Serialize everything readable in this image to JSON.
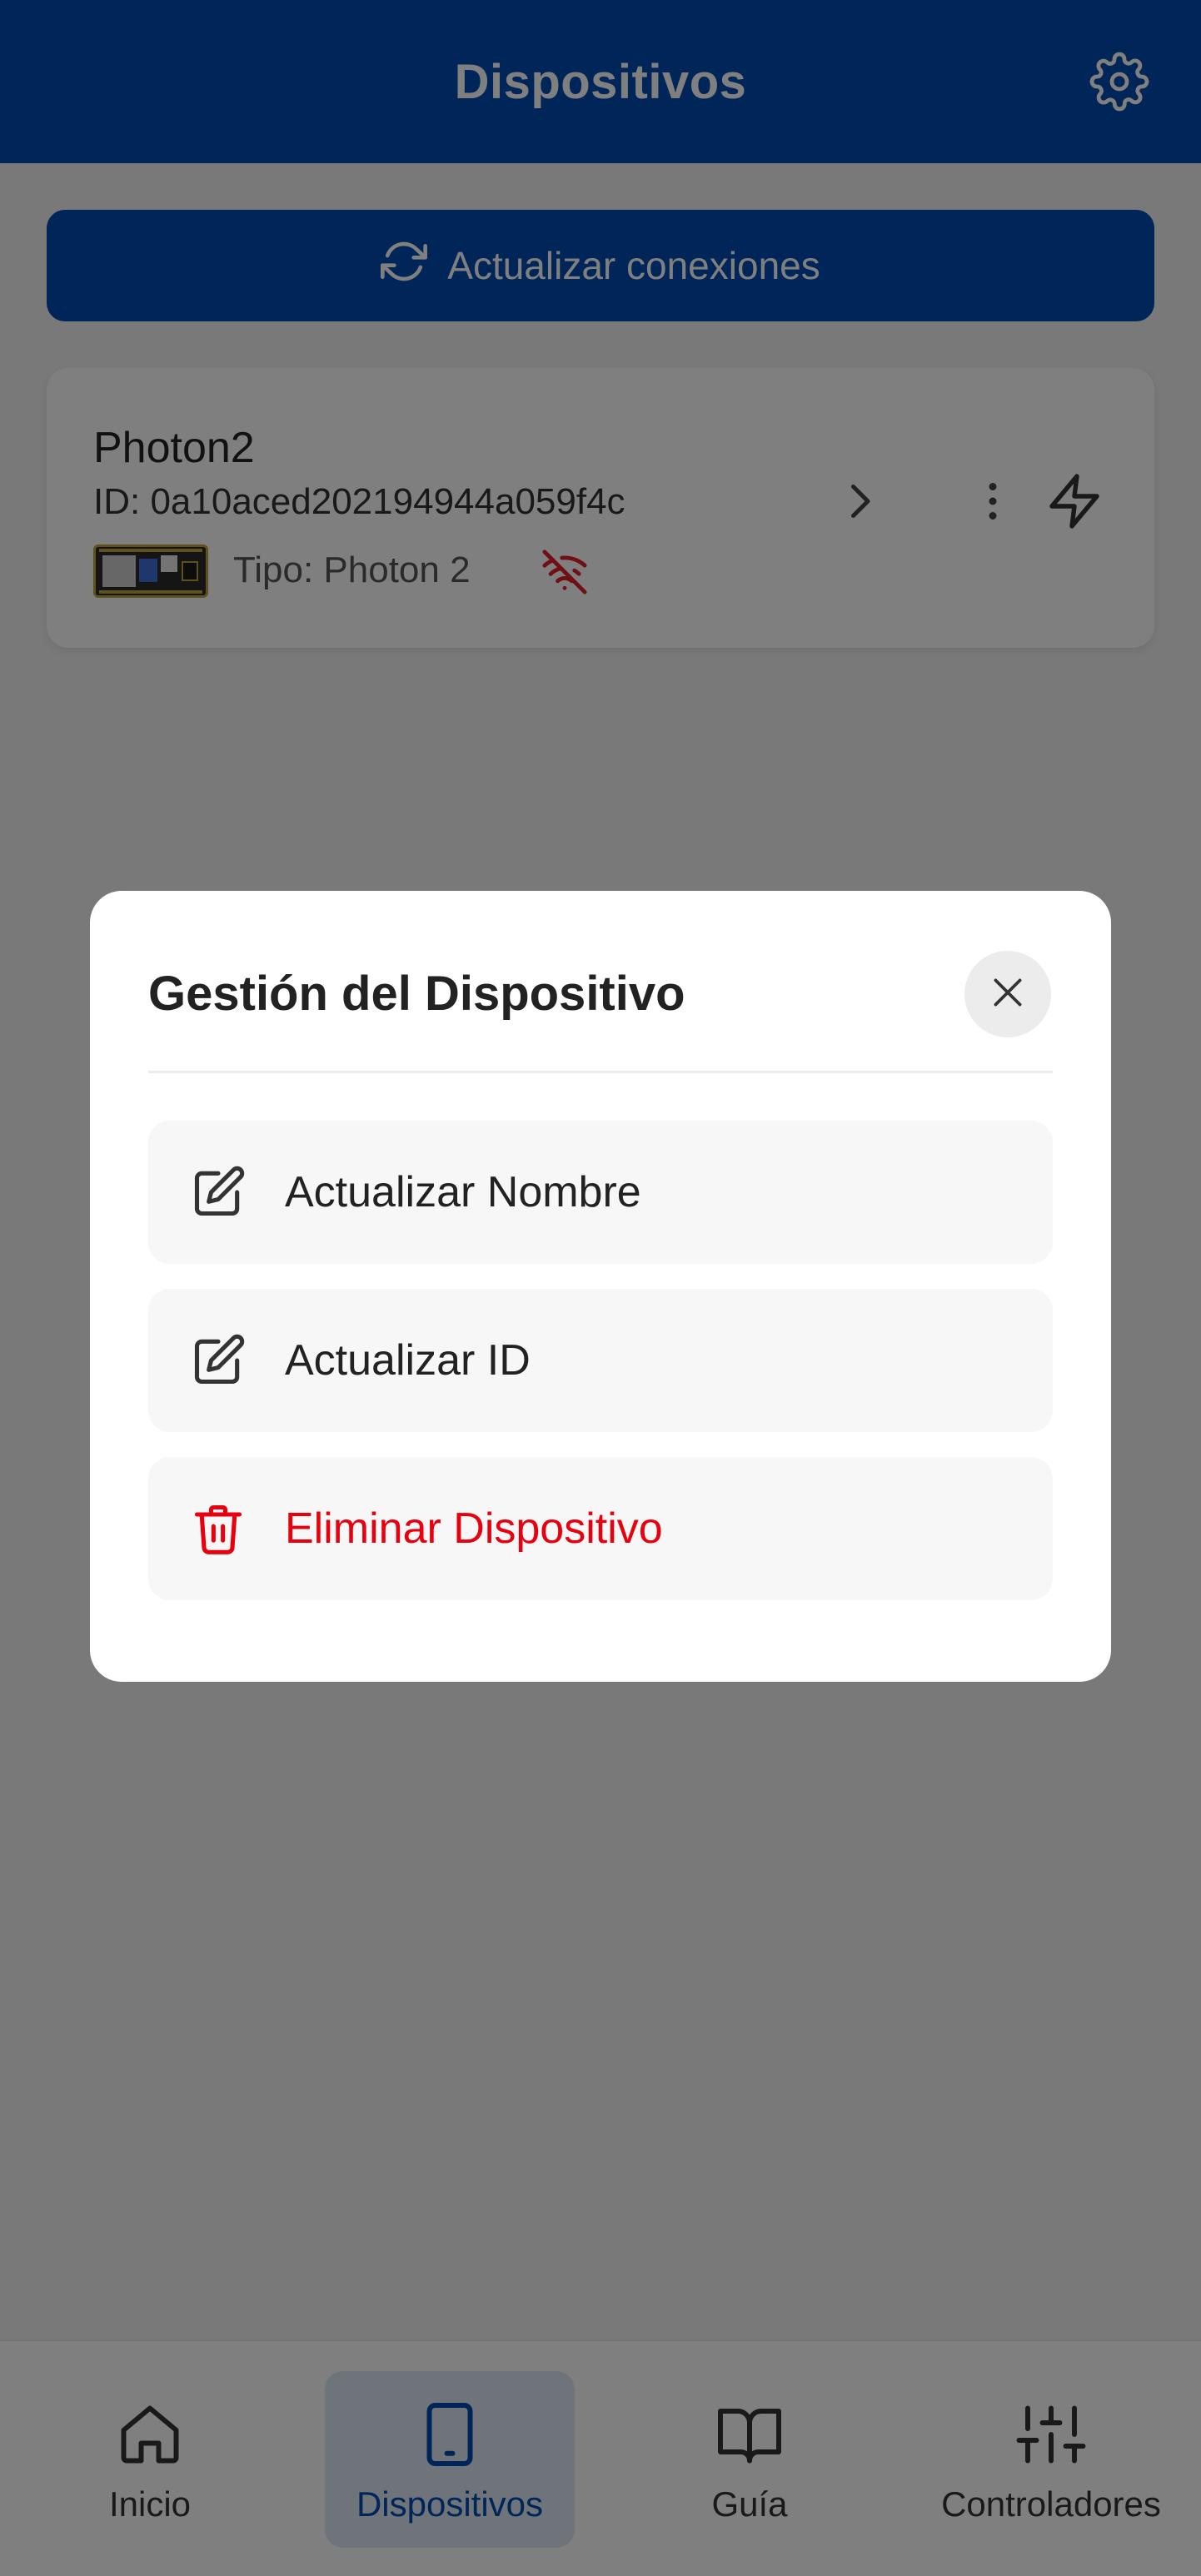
{
  "header": {
    "title": "Dispositivos",
    "settings_icon": "gear-icon"
  },
  "refresh": {
    "label": "Actualizar conexiones",
    "icon": "refresh-icon"
  },
  "device": {
    "name": "Photon2",
    "id": "ID: 0a10aced202194944a059f4c",
    "type": "Tipo: Photon 2",
    "status_icon": "wifi-off-icon",
    "status_color": "#e0202a"
  },
  "modal": {
    "title": "Gestión del Dispositivo",
    "options": [
      {
        "label": "Actualizar Nombre",
        "icon": "edit-icon"
      },
      {
        "label": "Actualizar ID",
        "icon": "edit-icon"
      },
      {
        "label": "Eliminar Dispositivo",
        "icon": "trash-icon",
        "color": "#e8000e"
      }
    ]
  },
  "nav": {
    "items": [
      {
        "label": "Inicio",
        "icon": "home-icon",
        "active": false
      },
      {
        "label": "Dispositivos",
        "icon": "tablet-icon",
        "active": true
      },
      {
        "label": "Guía",
        "icon": "book-icon",
        "active": false
      },
      {
        "label": "Controladores",
        "icon": "sliders-icon",
        "active": false
      }
    ]
  },
  "colors": {
    "primary": "#004ab0",
    "danger": "#e8000e",
    "overlay": "rgba(0,0,0,0.5)"
  }
}
